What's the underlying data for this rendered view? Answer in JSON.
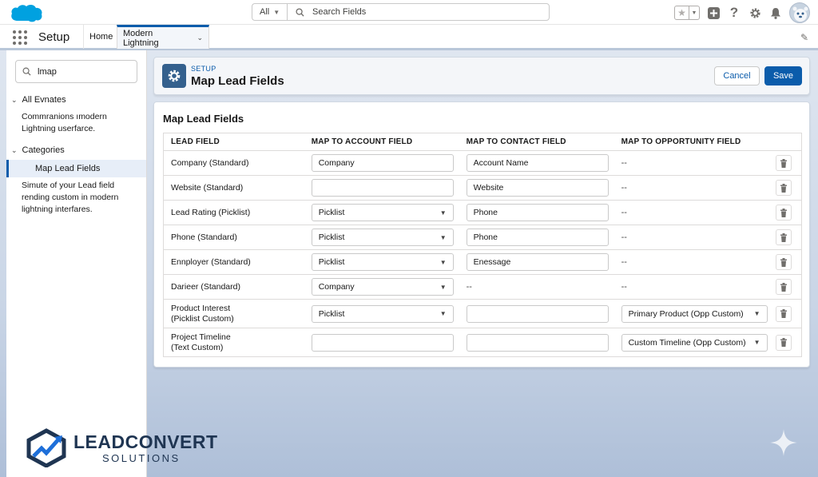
{
  "header": {
    "search_scope": "All",
    "search_placeholder": "Search Fields"
  },
  "nav": {
    "app_name": "Setup",
    "tabs": [
      {
        "label": "Home"
      },
      {
        "label": "Modern Lightning"
      }
    ]
  },
  "sidebar": {
    "quick_find_value": "lmap",
    "sections": [
      {
        "label": "All Evnates",
        "description": "Commranions ımodern Lightning userfarce."
      },
      {
        "label": "Categories",
        "active_item": "Map Lead Fields",
        "description": "Simute of your Lead field rending custom in modern lightning interfares."
      }
    ]
  },
  "page_header": {
    "eyebrow": "SETUP",
    "title": "Map Lead Fields",
    "cancel_label": "Cancel",
    "save_label": "Save"
  },
  "main": {
    "title": "Map Lead Fields",
    "columns": [
      "LEAD FIELD",
      "MAP TO ACCOUNT FIELD",
      "MAP TO CONTACT FIELD",
      "MAP TO OPPORTUNITY FIELD"
    ],
    "rows": [
      {
        "lead": "Company (Standard)",
        "account": "Company",
        "account_type": "input",
        "contact": "Account Name",
        "contact_type": "input",
        "opportunity": "--",
        "opportunity_type": "dash"
      },
      {
        "lead": "Website (Standard)",
        "account": "",
        "account_type": "input",
        "contact": "Website",
        "contact_type": "input",
        "opportunity": "--",
        "opportunity_type": "dash"
      },
      {
        "lead": "Lead Rating (Picklist)",
        "account": "Picklist",
        "account_type": "select",
        "contact": "Phone",
        "contact_type": "input",
        "opportunity": "--",
        "opportunity_type": "dash"
      },
      {
        "lead": "Phone (Standard)",
        "account": "Picklist",
        "account_type": "select",
        "contact": "Phone",
        "contact_type": "input",
        "opportunity": "--",
        "opportunity_type": "dash"
      },
      {
        "lead": "Ennployer (Standard)",
        "account": "Picklist",
        "account_type": "select",
        "contact": "Enessage",
        "contact_type": "input",
        "opportunity": "--",
        "opportunity_type": "dash"
      },
      {
        "lead": "Darieer (Standard)",
        "account": "Company",
        "account_type": "select",
        "contact": "--",
        "contact_type": "dash",
        "opportunity": "--",
        "opportunity_type": "dash"
      },
      {
        "lead": "Product Interest",
        "lead2": "(Picklist Custom)",
        "account": "Picklist",
        "account_type": "select",
        "contact": "",
        "contact_type": "input",
        "opportunity": "Primary Product (Opp Custom)",
        "opportunity_type": "select"
      },
      {
        "lead": "Project Timeline",
        "lead2": "(Text Custom)",
        "account": "",
        "account_type": "input",
        "contact": "",
        "contact_type": "input",
        "opportunity": "Custom Timeline (Opp Custom)",
        "opportunity_type": "select"
      }
    ]
  },
  "branding": {
    "name": "LEADCONVERT",
    "sub": "SOLUTIONS"
  },
  "colors": {
    "brand_blue": "#0b5cab",
    "salesforce_cloud": "#00a1e0",
    "setup_icon_bg": "#34608d"
  },
  "icons": [
    "salesforce-cloud-icon",
    "search-icon",
    "star-icon",
    "add-icon",
    "help-icon",
    "gear-icon",
    "bell-icon",
    "waffle-icon",
    "pencil-icon",
    "trash-icon",
    "sparkle-icon"
  ]
}
